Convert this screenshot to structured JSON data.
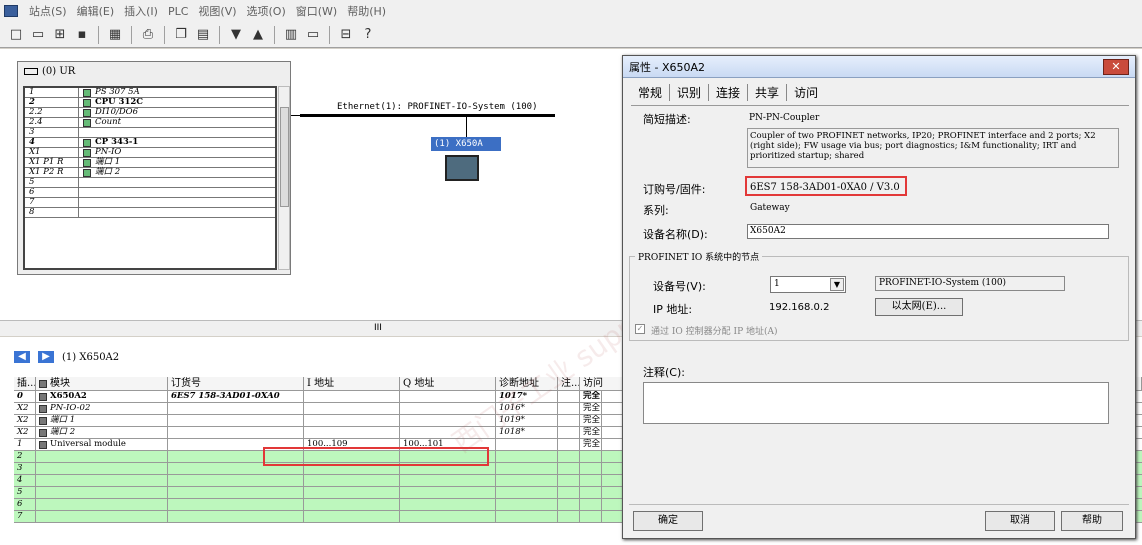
{
  "menu": [
    "站点(S)",
    "编辑(E)",
    "插入(I)",
    "PLC",
    "视图(V)",
    "选项(O)",
    "窗口(W)",
    "帮助(H)"
  ],
  "toolbar_icons": [
    "new-icon",
    "open-icon",
    "network-icon",
    "save-icon",
    "compile-icon",
    "print-icon",
    "copy-icon",
    "paste-icon",
    "download-icon",
    "upload-icon",
    "catalog-icon",
    "monitor-icon",
    "netpro-icon",
    "help-icon"
  ],
  "rack": {
    "title": "(0) UR",
    "rows": [
      {
        "slot": "1",
        "module": "PS 307 5A",
        "bold": false
      },
      {
        "slot": "2",
        "module": "CPU 312C",
        "bold": true
      },
      {
        "slot": "2.2",
        "module": "DI10/DO6",
        "bold": false
      },
      {
        "slot": "2.4",
        "module": "Count",
        "bold": false
      },
      {
        "slot": "3",
        "module": "",
        "bold": false
      },
      {
        "slot": "4",
        "module": "CP 343-1",
        "bold": true
      },
      {
        "slot": "X1",
        "module": "PN-IO",
        "bold": false
      },
      {
        "slot": "X1 P1 R",
        "module": "端口 1",
        "bold": false
      },
      {
        "slot": "X1 P2 R",
        "module": "端口 2",
        "bold": false
      },
      {
        "slot": "5",
        "module": "",
        "bold": false
      },
      {
        "slot": "6",
        "module": "",
        "bold": false
      },
      {
        "slot": "7",
        "module": "",
        "bold": false
      },
      {
        "slot": "8",
        "module": "",
        "bold": false
      }
    ]
  },
  "network": {
    "label": "Ethernet(1): PROFINET-IO-System (100)",
    "device": "(1) X650A"
  },
  "scroll_label": "III",
  "bottom": {
    "nav_title": "(1)   X650A2",
    "headers": [
      "插...",
      "模块",
      "订货号",
      "I 地址",
      "Q 地址",
      "诊断地址",
      "注...",
      "访问"
    ],
    "rows": [
      {
        "slot": "0",
        "module": "X650A2",
        "order": "6ES7 158-3AD01-0XA0",
        "i": "",
        "q": "",
        "diag": "1017*",
        "note": "",
        "access": "完全",
        "bold": true,
        "green": false
      },
      {
        "slot": "X2",
        "module": "PN-IO-02",
        "order": "",
        "i": "",
        "q": "",
        "diag": "1016*",
        "note": "",
        "access": "完全",
        "bold": false,
        "green": false
      },
      {
        "slot": "X2",
        "module": "端口 1",
        "order": "",
        "i": "",
        "q": "",
        "diag": "1019*",
        "note": "",
        "access": "完全",
        "bold": false,
        "green": false
      },
      {
        "slot": "X2",
        "module": "端口 2",
        "order": "",
        "i": "",
        "q": "",
        "diag": "1018*",
        "note": "",
        "access": "完全",
        "bold": false,
        "green": false
      },
      {
        "slot": "1",
        "module": "Universal module",
        "order": "",
        "i": "100...109",
        "q": "100...101",
        "diag": "",
        "note": "",
        "access": "完全",
        "bold": false,
        "green": false
      },
      {
        "slot": "2",
        "module": "",
        "order": "",
        "i": "",
        "q": "",
        "diag": "",
        "note": "",
        "access": "",
        "bold": false,
        "green": true
      },
      {
        "slot": "3",
        "module": "",
        "order": "",
        "i": "",
        "q": "",
        "diag": "",
        "note": "",
        "access": "",
        "bold": false,
        "green": true
      },
      {
        "slot": "4",
        "module": "",
        "order": "",
        "i": "",
        "q": "",
        "diag": "",
        "note": "",
        "access": "",
        "bold": false,
        "green": true
      },
      {
        "slot": "5",
        "module": "",
        "order": "",
        "i": "",
        "q": "",
        "diag": "",
        "note": "",
        "access": "",
        "bold": false,
        "green": true
      },
      {
        "slot": "6",
        "module": "",
        "order": "",
        "i": "",
        "q": "",
        "diag": "",
        "note": "",
        "access": "",
        "bold": false,
        "green": true
      },
      {
        "slot": "7",
        "module": "",
        "order": "",
        "i": "",
        "q": "",
        "diag": "",
        "note": "",
        "access": "",
        "bold": false,
        "green": true
      }
    ]
  },
  "watermark": "西门子工业 support.industry.siemens.com/cs",
  "dialog": {
    "title": "属性 - X650A2",
    "close": "✕",
    "tabs": [
      "常规",
      "识别",
      "连接",
      "共享",
      "访问"
    ],
    "short_desc_label": "简短描述:",
    "short_desc": "PN-PN-Coupler",
    "long_desc": "Coupler of two PROFINET networks, IP20; PROFINET interface and 2 ports; X2 (right side); FW usage via bus; port diagnostics; I&M functionality; IRT and prioritized startup; shared",
    "order_label": "订购号/固件:",
    "order_value": "6ES7 158-3AD01-0XA0 / V3.0",
    "family_label": "系列:",
    "family_value": "Gateway",
    "device_name_label": "设备名称(D):",
    "device_name_value": "X650A2",
    "group_title": "PROFINET IO 系统中的节点",
    "device_no_label": "设备号(V):",
    "device_no_value": "1",
    "system_value": "PROFINET-IO-System (100)",
    "ip_label": "IP 地址:",
    "ip_value": "192.168.0.2",
    "ethernet_button": "以太网(E)...",
    "assign_ip_label": "通过 IO 控制器分配 IP 地址(A)",
    "assign_ip_checked": true,
    "comment_label": "注释(C):",
    "comment_value": "",
    "ok": "确定",
    "cancel": "取消",
    "help": "帮助"
  }
}
